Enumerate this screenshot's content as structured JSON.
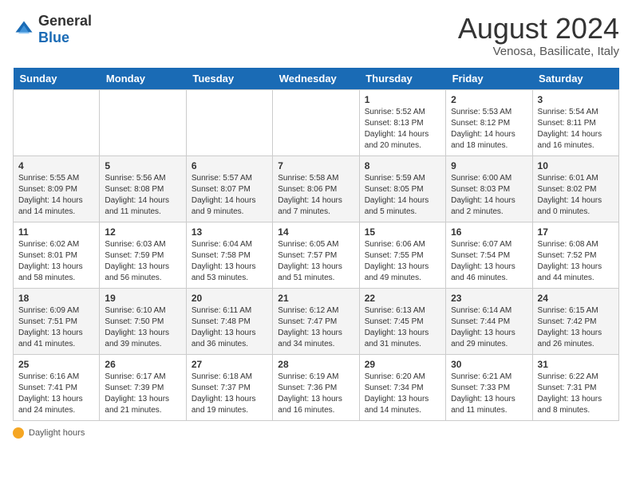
{
  "header": {
    "logo_general": "General",
    "logo_blue": "Blue",
    "title": "August 2024",
    "subtitle": "Venosa, Basilicate, Italy"
  },
  "days_of_week": [
    "Sunday",
    "Monday",
    "Tuesday",
    "Wednesday",
    "Thursday",
    "Friday",
    "Saturday"
  ],
  "weeks": [
    [
      {
        "day": "",
        "info": ""
      },
      {
        "day": "",
        "info": ""
      },
      {
        "day": "",
        "info": ""
      },
      {
        "day": "",
        "info": ""
      },
      {
        "day": "1",
        "info": "Sunrise: 5:52 AM\nSunset: 8:13 PM\nDaylight: 14 hours and 20 minutes."
      },
      {
        "day": "2",
        "info": "Sunrise: 5:53 AM\nSunset: 8:12 PM\nDaylight: 14 hours and 18 minutes."
      },
      {
        "day": "3",
        "info": "Sunrise: 5:54 AM\nSunset: 8:11 PM\nDaylight: 14 hours and 16 minutes."
      }
    ],
    [
      {
        "day": "4",
        "info": "Sunrise: 5:55 AM\nSunset: 8:09 PM\nDaylight: 14 hours and 14 minutes."
      },
      {
        "day": "5",
        "info": "Sunrise: 5:56 AM\nSunset: 8:08 PM\nDaylight: 14 hours and 11 minutes."
      },
      {
        "day": "6",
        "info": "Sunrise: 5:57 AM\nSunset: 8:07 PM\nDaylight: 14 hours and 9 minutes."
      },
      {
        "day": "7",
        "info": "Sunrise: 5:58 AM\nSunset: 8:06 PM\nDaylight: 14 hours and 7 minutes."
      },
      {
        "day": "8",
        "info": "Sunrise: 5:59 AM\nSunset: 8:05 PM\nDaylight: 14 hours and 5 minutes."
      },
      {
        "day": "9",
        "info": "Sunrise: 6:00 AM\nSunset: 8:03 PM\nDaylight: 14 hours and 2 minutes."
      },
      {
        "day": "10",
        "info": "Sunrise: 6:01 AM\nSunset: 8:02 PM\nDaylight: 14 hours and 0 minutes."
      }
    ],
    [
      {
        "day": "11",
        "info": "Sunrise: 6:02 AM\nSunset: 8:01 PM\nDaylight: 13 hours and 58 minutes."
      },
      {
        "day": "12",
        "info": "Sunrise: 6:03 AM\nSunset: 7:59 PM\nDaylight: 13 hours and 56 minutes."
      },
      {
        "day": "13",
        "info": "Sunrise: 6:04 AM\nSunset: 7:58 PM\nDaylight: 13 hours and 53 minutes."
      },
      {
        "day": "14",
        "info": "Sunrise: 6:05 AM\nSunset: 7:57 PM\nDaylight: 13 hours and 51 minutes."
      },
      {
        "day": "15",
        "info": "Sunrise: 6:06 AM\nSunset: 7:55 PM\nDaylight: 13 hours and 49 minutes."
      },
      {
        "day": "16",
        "info": "Sunrise: 6:07 AM\nSunset: 7:54 PM\nDaylight: 13 hours and 46 minutes."
      },
      {
        "day": "17",
        "info": "Sunrise: 6:08 AM\nSunset: 7:52 PM\nDaylight: 13 hours and 44 minutes."
      }
    ],
    [
      {
        "day": "18",
        "info": "Sunrise: 6:09 AM\nSunset: 7:51 PM\nDaylight: 13 hours and 41 minutes."
      },
      {
        "day": "19",
        "info": "Sunrise: 6:10 AM\nSunset: 7:50 PM\nDaylight: 13 hours and 39 minutes."
      },
      {
        "day": "20",
        "info": "Sunrise: 6:11 AM\nSunset: 7:48 PM\nDaylight: 13 hours and 36 minutes."
      },
      {
        "day": "21",
        "info": "Sunrise: 6:12 AM\nSunset: 7:47 PM\nDaylight: 13 hours and 34 minutes."
      },
      {
        "day": "22",
        "info": "Sunrise: 6:13 AM\nSunset: 7:45 PM\nDaylight: 13 hours and 31 minutes."
      },
      {
        "day": "23",
        "info": "Sunrise: 6:14 AM\nSunset: 7:44 PM\nDaylight: 13 hours and 29 minutes."
      },
      {
        "day": "24",
        "info": "Sunrise: 6:15 AM\nSunset: 7:42 PM\nDaylight: 13 hours and 26 minutes."
      }
    ],
    [
      {
        "day": "25",
        "info": "Sunrise: 6:16 AM\nSunset: 7:41 PM\nDaylight: 13 hours and 24 minutes."
      },
      {
        "day": "26",
        "info": "Sunrise: 6:17 AM\nSunset: 7:39 PM\nDaylight: 13 hours and 21 minutes."
      },
      {
        "day": "27",
        "info": "Sunrise: 6:18 AM\nSunset: 7:37 PM\nDaylight: 13 hours and 19 minutes."
      },
      {
        "day": "28",
        "info": "Sunrise: 6:19 AM\nSunset: 7:36 PM\nDaylight: 13 hours and 16 minutes."
      },
      {
        "day": "29",
        "info": "Sunrise: 6:20 AM\nSunset: 7:34 PM\nDaylight: 13 hours and 14 minutes."
      },
      {
        "day": "30",
        "info": "Sunrise: 6:21 AM\nSunset: 7:33 PM\nDaylight: 13 hours and 11 minutes."
      },
      {
        "day": "31",
        "info": "Sunrise: 6:22 AM\nSunset: 7:31 PM\nDaylight: 13 hours and 8 minutes."
      }
    ]
  ],
  "footer": {
    "label": "Daylight hours"
  }
}
